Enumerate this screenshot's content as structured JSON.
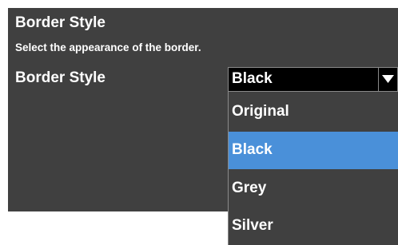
{
  "panel": {
    "title": "Border Style",
    "description": "Select the appearance of the border.",
    "row_label": "Border Style"
  },
  "select": {
    "value": "Black",
    "icon": "triangle-down-icon",
    "options": [
      "Original",
      "Black",
      "Grey",
      "Silver"
    ],
    "selected_index": 1
  },
  "colors": {
    "panel_bg": "#404040",
    "select_bg": "#000000",
    "highlight": "#4a90d9",
    "text": "#ffffff"
  }
}
